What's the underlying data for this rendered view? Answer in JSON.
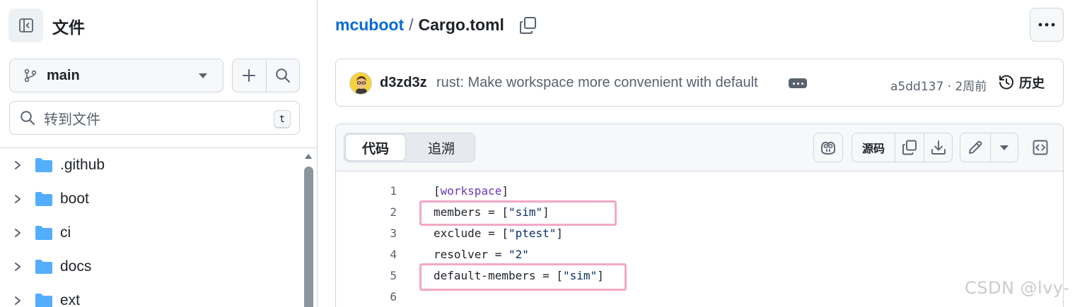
{
  "sidebar": {
    "toggle_icon": "sidebar-collapse-icon",
    "title": "文件",
    "branch": {
      "name": "main",
      "icon": "git-branch-icon"
    },
    "add_icon": "plus-icon",
    "search_icon": "search-icon",
    "file_search": {
      "placeholder": "转到文件",
      "shortcut": "t"
    },
    "tree": [
      {
        "name": ".github",
        "type": "folder"
      },
      {
        "name": "boot",
        "type": "folder"
      },
      {
        "name": "ci",
        "type": "folder"
      },
      {
        "name": "docs",
        "type": "folder"
      },
      {
        "name": "ext",
        "type": "folder"
      }
    ]
  },
  "breadcrumb": {
    "repo": "mcuboot",
    "separator": "/",
    "file": "Cargo.toml"
  },
  "commit": {
    "author": "d3zd3z",
    "message": "rust: Make workspace more convenient with default",
    "hash": "a5dd137",
    "time": "2周前",
    "meta": "a5dd137 · 2周前",
    "history_label": "历史"
  },
  "code_view": {
    "tabs": [
      {
        "label": "代码",
        "selected": true
      },
      {
        "label": "追溯",
        "selected": false
      }
    ],
    "raw_label": "源码",
    "lines": [
      {
        "number": "1",
        "text": "[workspace]"
      },
      {
        "number": "2",
        "text": "members = [\"sim\"]"
      },
      {
        "number": "3",
        "text": "exclude = [\"ptest\"]"
      },
      {
        "number": "4",
        "text": "resolver = \"2\""
      },
      {
        "number": "5",
        "text": "default-members = [\"sim\"]"
      },
      {
        "number": "6",
        "text": ""
      }
    ],
    "highlighted_lines": [
      "2",
      "5"
    ]
  },
  "watermark": "CSDN @lvy-",
  "colors": {
    "link": "#0969da",
    "border": "#d0d7de",
    "muted": "#59636e",
    "folder": "#54aeff",
    "highlight_box": "#f4a8c7"
  }
}
